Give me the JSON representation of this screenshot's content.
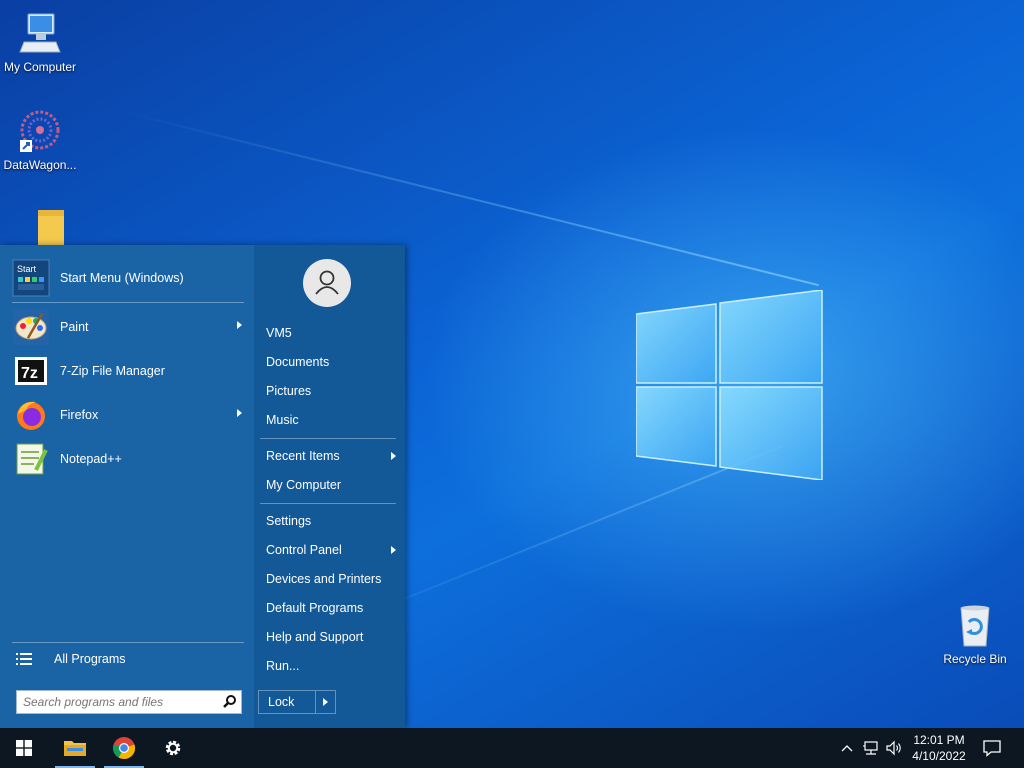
{
  "desktop": {
    "icons": [
      {
        "label": "My Computer",
        "icon": "computer-icon"
      },
      {
        "label": "DataWagon...",
        "icon": "datawagon-icon"
      },
      {
        "label": "",
        "icon": "folder-icon"
      },
      {
        "label": "Recycle Bin",
        "icon": "recycle-bin-icon"
      }
    ]
  },
  "start_menu": {
    "pinned": [
      {
        "label": "Start Menu (Windows)",
        "icon": "start-menu-icon",
        "submenu": false
      },
      {
        "label": "Paint",
        "icon": "paint-icon",
        "submenu": true
      },
      {
        "label": "7-Zip File Manager",
        "icon": "7zip-icon",
        "submenu": false
      },
      {
        "label": "Firefox",
        "icon": "firefox-icon",
        "submenu": true
      },
      {
        "label": "Notepad++",
        "icon": "notepadpp-icon",
        "submenu": false
      }
    ],
    "start_menu_icon_text": "Start",
    "sevenzip_icon_text": "7z",
    "all_programs": "All Programs",
    "search_placeholder": "Search programs and files",
    "right": {
      "user": "VM5",
      "links1": [
        "Documents",
        "Pictures",
        "Music"
      ],
      "links2": [
        {
          "label": "Recent Items",
          "submenu": true
        },
        {
          "label": "My Computer",
          "submenu": false
        }
      ],
      "links3": [
        {
          "label": "Settings",
          "submenu": false
        },
        {
          "label": "Control Panel",
          "submenu": true
        },
        {
          "label": "Devices and Printers",
          "submenu": false
        },
        {
          "label": "Default Programs",
          "submenu": false
        },
        {
          "label": "Help and Support",
          "submenu": false
        },
        {
          "label": "Run...",
          "submenu": false
        }
      ],
      "lock_label": "Lock"
    }
  },
  "taskbar": {
    "pinned": [
      "windows-start-icon",
      "file-explorer-icon",
      "chrome-icon",
      "settings-gear-icon"
    ],
    "tray": [
      "chevron-up-icon",
      "network-icon",
      "volume-icon"
    ],
    "time": "12:01 PM",
    "date": "4/10/2022",
    "notification_icon": "action-center-icon"
  },
  "colors": {
    "start_menu_left": "#1a64a6",
    "start_menu_right": "#135897",
    "taskbar": "#0c1722",
    "desktop_accent": "#0b63d4"
  }
}
